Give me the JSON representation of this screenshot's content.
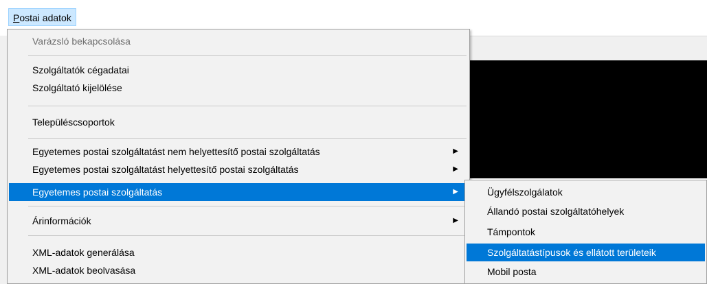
{
  "menubar": {
    "title_mnemonic": "P",
    "title_rest": "ostai adatok"
  },
  "main_menu": {
    "items": [
      {
        "label": "Varázsló bekapcsolása"
      },
      {
        "label": "Szolgáltatók cégadatai"
      },
      {
        "label": "Szolgáltató kijelölése"
      },
      {
        "label": "Településcsoportok"
      },
      {
        "label": "Egyetemes postai szolgáltatást nem helyettesítő postai szolgáltatás",
        "arrow": "▶"
      },
      {
        "label": "Egyetemes postai szolgáltatást helyettesítő postai szolgáltatás",
        "arrow": "▶"
      },
      {
        "label": "Egyetemes postai szolgáltatás",
        "arrow": "▶"
      },
      {
        "label": "Árinformációk",
        "arrow": "▶"
      },
      {
        "label": "XML-adatok generálása"
      },
      {
        "label": "XML-adatok beolvasása"
      }
    ]
  },
  "sub_menu": {
    "items": [
      {
        "label": "Ügyfélszolgálatok"
      },
      {
        "label": "Állandó postai szolgáltatóhelyek"
      },
      {
        "label": "Támpontok"
      },
      {
        "label": "Szolgáltatástípusok és ellátott területeik"
      },
      {
        "label": "Mobil posta"
      }
    ]
  }
}
